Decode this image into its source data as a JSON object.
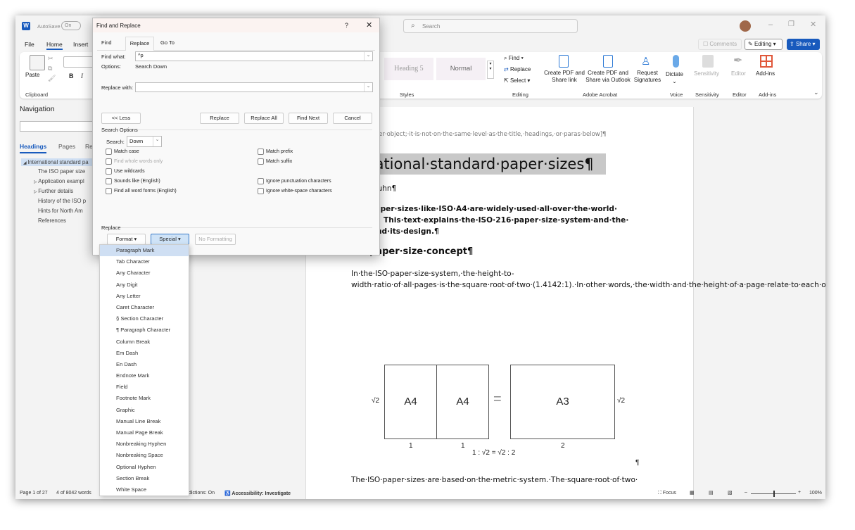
{
  "titlebar": {
    "autosave": "AutoSave",
    "autosave_state": "On",
    "search_placeholder": "Search"
  },
  "menu_tabs": [
    "File",
    "Home",
    "Insert"
  ],
  "topright": {
    "comments": "Comments",
    "editing": "Editing",
    "share": "Share"
  },
  "ribbon": {
    "clipboard": {
      "paste": "Paste",
      "group": "Clipboard"
    },
    "styles": {
      "items": [
        "Heading 5",
        "Normal"
      ],
      "group": "Styles"
    },
    "editing": {
      "find": "Find",
      "replace": "Replace",
      "select": "Select",
      "group": "Editing"
    },
    "acrobat": {
      "create_pdf": "Create PDF and Share link",
      "create_outlook": "Create PDF and Share via Outlook",
      "request": "Request Signatures",
      "group": "Adobe Acrobat"
    },
    "voice": {
      "dictate": "Dictate",
      "group": "Voice"
    },
    "sensitivity": {
      "label": "Sensitivity",
      "group": "Sensitivity"
    },
    "editor": {
      "label": "Editor",
      "group": "Editor"
    },
    "addins": {
      "label": "Add-ins",
      "group": "Add-ins"
    }
  },
  "navigation": {
    "title": "Navigation",
    "tabs": [
      "Headings",
      "Pages",
      "Res"
    ],
    "items": [
      "International standard pa",
      "The ISO paper size",
      "Application exampl",
      "Further details",
      "History of the ISO p",
      "Hints for North Am",
      "References"
    ]
  },
  "dialog": {
    "title": "Find and Replace",
    "help": "?",
    "tabs": [
      "Find",
      "Replace",
      "Go To"
    ],
    "active_tab": "Replace",
    "find_label": "Find what:",
    "find_value": "^p",
    "options_label": "Options:",
    "options_value": "Search Down",
    "replace_label": "Replace with:",
    "replace_value": "",
    "less": "<< Less",
    "replace_btn": "Replace",
    "replace_all": "Replace All",
    "find_next": "Find Next",
    "cancel": "Cancel",
    "search_options": "Search Options",
    "search_label": "Search:",
    "search_value": "Down",
    "checks_left": [
      "Match case",
      "Find whole words only",
      "Use wildcards",
      "Sounds like (English)",
      "Find all word forms (English)"
    ],
    "checks_right": [
      "Match prefix",
      "Match suffix",
      "Ignore punctuation characters",
      "Ignore white-space characters"
    ],
    "replace_section": "Replace",
    "format": "Format ▾",
    "special": "Special ▾",
    "no_formatting": "No Formatting"
  },
  "special_menu": [
    "Paragraph Mark",
    "Tab Character",
    "Any Character",
    "Any Digit",
    "Any Letter",
    "Caret Character",
    "§ Section Character",
    "¶ Paragraph Character",
    "Column Break",
    "Em Dash",
    "En Dash",
    "Endnote Mark",
    "Field",
    "Footnote Mark",
    "Graphic",
    "Manual Line Break",
    "Manual Page Break",
    "Nonbreaking Hyphen",
    "Nonbreaking Space",
    "Optional Hyphen",
    "Section Break",
    "White Space"
  ],
  "document": {
    "header_note": "e·header·object;·it·is·not·on·the·same·level·as·the·title,·headings,·or·paras·below]¶",
    "title": "rnational·standard·paper·sizes¶",
    "author": "kus·Kuhn¶",
    "abstract": [
      "rd·paper·sizes·like·ISO·A4·are·widely·used·all·over·the·world·",
      "This·text·explains·the·ISO·216·paper·size·system·and·the·",
      "behind·its·design.¶"
    ],
    "heading": "O·paper·size·concept¶",
    "paragraph": "In·the·ISO·paper·size·system,·the·height-to-width·ratio·of·all·pages·is·the·square·root·of·two·(1.4142:1).·In·other·words,·the·width·and·the·height·of·a·page·relate·to·each·other·like·the·side·and·the·diagonal·of·a·square.·This·aspect·ratio·is·especially·convenient·for·a·paper·size.·If·you·put·two·such·pages·next·to·each·other,·or·equivalently·cut·one·parallel·to·its·shorter·side·into·two·equal·pieces,·then·the·resulting·page·will·have·again·the·same·width/height·ratio.¶",
    "figure": {
      "a4": "A4",
      "a3": "A3",
      "sqrt2": "√2",
      "one": "1",
      "two": "2",
      "equals": "=",
      "formula": "1 : √2 = √2 : 2",
      "pilcrow": "¶"
    },
    "next_line": "The·ISO·paper·sizes·are·based·on·the·metric·system.·The·square·root·of·two·"
  },
  "status": {
    "page": "Page 1 of 27",
    "words": "4 of 8042 words",
    "predictions": "dictions: On",
    "accessibility": "Accessibility: Investigate",
    "focus": "Focus",
    "zoom": "100%",
    "zoom_level": 100
  },
  "colors": {
    "accent": "#185abd",
    "selection": "#cfdff3",
    "title_highlight": "#c8c8c8"
  }
}
